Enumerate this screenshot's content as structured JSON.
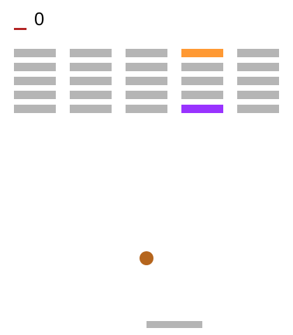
{
  "hud": {
    "score": "0",
    "lives_marker_color": "#b22222"
  },
  "bricks": {
    "default_color": "#b5b5b5",
    "rows": [
      [
        "#b5b5b5",
        "#b5b5b5",
        "#b5b5b5",
        "#ff9933",
        "#b5b5b5"
      ],
      [
        "#b5b5b5",
        "#b5b5b5",
        "#b5b5b5",
        "#b5b5b5",
        "#b5b5b5"
      ],
      [
        "#b5b5b5",
        "#b5b5b5",
        "#b5b5b5",
        "#b5b5b5",
        "#b5b5b5"
      ],
      [
        "#b5b5b5",
        "#b5b5b5",
        "#b5b5b5",
        "#b5b5b5",
        "#b5b5b5"
      ],
      [
        "#b5b5b5",
        "#b5b5b5",
        "#b5b5b5",
        "#9933ff",
        "#b5b5b5"
      ]
    ]
  },
  "ball": {
    "color": "#b5651d"
  },
  "paddle": {
    "color": "#b5b5b5"
  }
}
